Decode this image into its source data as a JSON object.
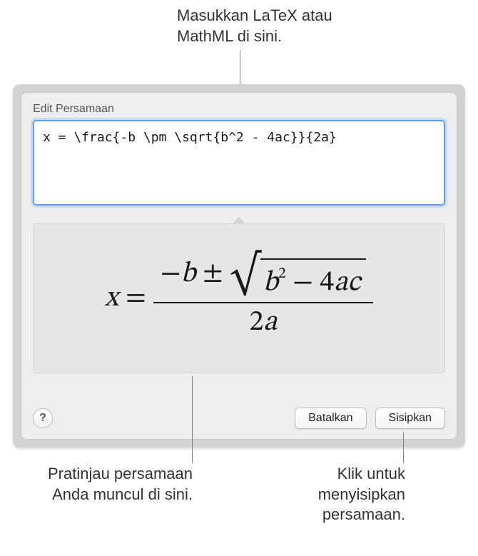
{
  "callouts": {
    "top": "Masukkan LaTeX atau MathML di sini.",
    "bottom_left": "Pratinjau persamaan Anda muncul di sini.",
    "bottom_right": "Klik untuk menyisipkan persamaan."
  },
  "dialog": {
    "title": "Edit Persamaan",
    "input_value": "x = \\frac{-b \\pm \\sqrt{b^2 - 4ac}}{2a}",
    "help_label": "?",
    "cancel_label": "Batalkan",
    "insert_label": "Sisipkan"
  },
  "formula": {
    "lhs": "x",
    "eq": "=",
    "minus": "−",
    "b": "b",
    "pm": "±",
    "sup2": "2",
    "four": "4",
    "a": "a",
    "c": "c",
    "two": "2"
  }
}
